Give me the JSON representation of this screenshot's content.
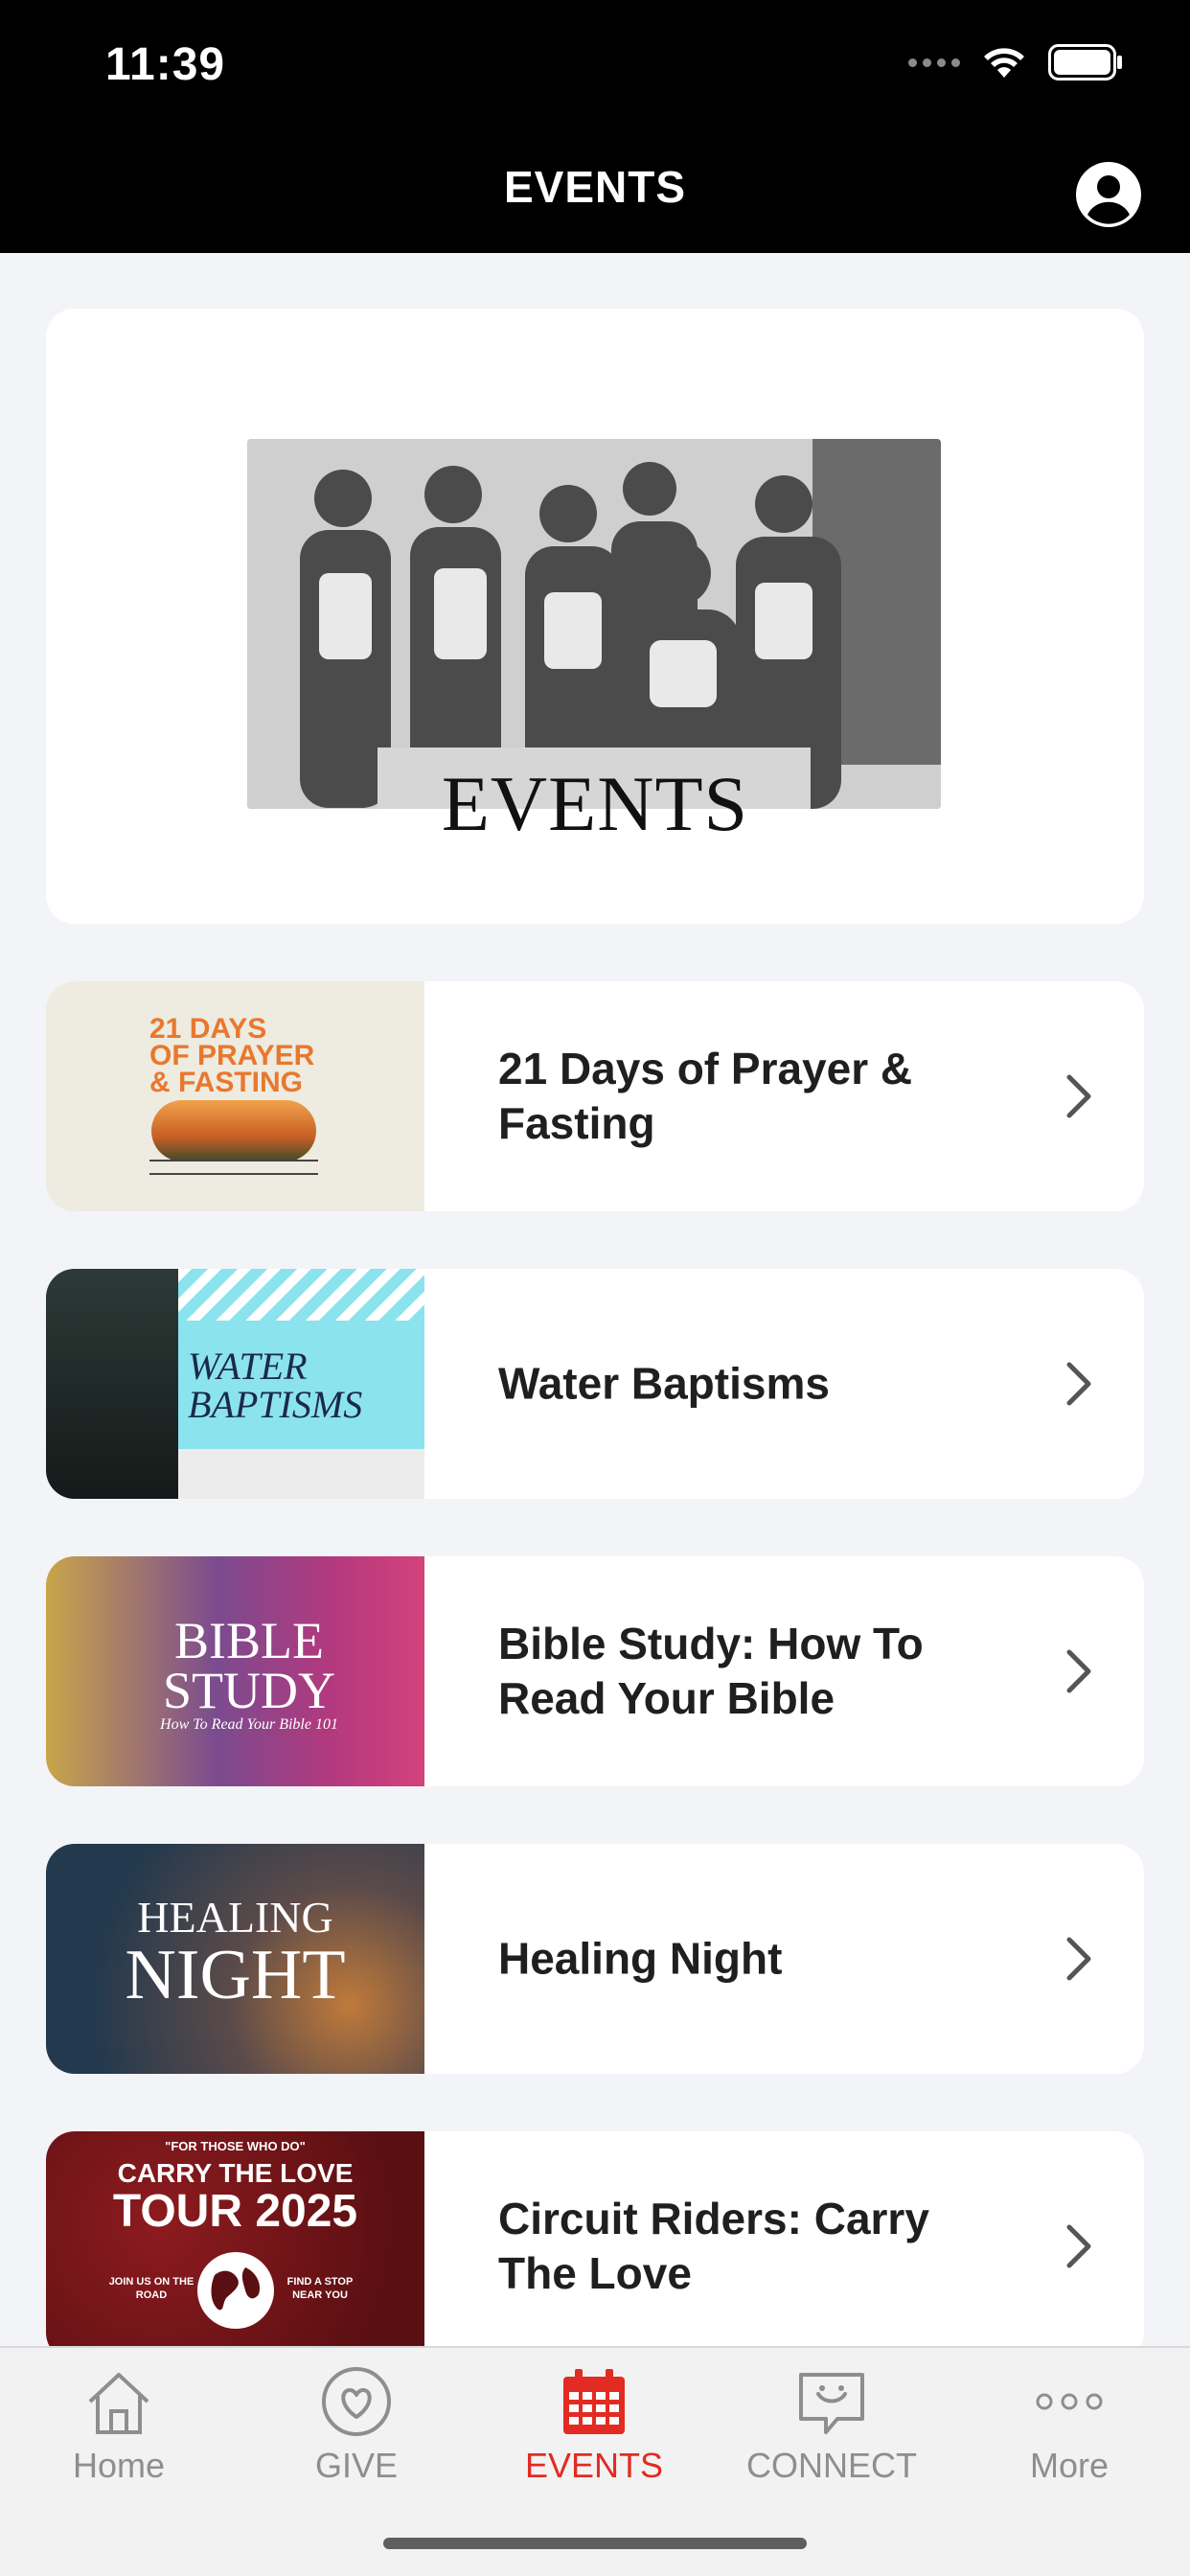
{
  "status_bar": {
    "time": "11:39"
  },
  "header": {
    "title": "EVENTS"
  },
  "hero": {
    "title": "EVENTS"
  },
  "events": [
    {
      "title": "21 Days of Prayer & Fasting",
      "thumb_text": [
        "21 DAYS",
        "OF PRAYER",
        "& FASTING"
      ]
    },
    {
      "title": "Water Baptisms",
      "thumb_text": [
        "WATER",
        "BAPTISMS"
      ]
    },
    {
      "title": "Bible Study: How To Read Your Bible",
      "thumb_text": [
        "BIBLE",
        "STUDY",
        "How To Read Your Bible 101"
      ]
    },
    {
      "title": "Healing Night",
      "thumb_text": [
        "HEALING",
        "NIGHT"
      ]
    },
    {
      "title": "Circuit Riders: Carry The Love",
      "thumb_text": [
        "\"FOR THOSE WHO DO\"",
        "CARRY THE LOVE",
        "TOUR 2025",
        "JOIN US ON THE ROAD",
        "FIND A STOP NEAR YOU"
      ]
    }
  ],
  "tabbar": {
    "items": [
      {
        "label": "Home",
        "icon": "home-icon"
      },
      {
        "label": "GIVE",
        "icon": "heart-icon"
      },
      {
        "label": "EVENTS",
        "icon": "calendar-icon"
      },
      {
        "label": "CONNECT",
        "icon": "chat-icon"
      },
      {
        "label": "More",
        "icon": "more-icon"
      }
    ],
    "active_color": "#e22b23",
    "inactive_color": "#8e8e8e"
  }
}
